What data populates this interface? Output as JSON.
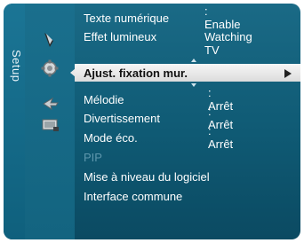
{
  "side_tab": {
    "label": "Setup"
  },
  "icons": [
    {
      "name": "picture-icon"
    },
    {
      "name": "setup-icon"
    },
    {
      "name": "input-icon"
    },
    {
      "name": "application-icon"
    }
  ],
  "menu": {
    "items": [
      {
        "label": "Texte numérique",
        "value": ": Enable"
      },
      {
        "label": "Effet lumineux",
        "value": ": Watching TV"
      },
      {
        "label": "Ajust. fixation mur.",
        "selected": true
      },
      {
        "label": "Mélodie",
        "value": ": Arrêt"
      },
      {
        "label": "Divertissement",
        "value": ": Arrêt"
      },
      {
        "label": "Mode éco.",
        "value": ": Arrêt"
      },
      {
        "label": "PIP",
        "disabled": true
      },
      {
        "label": "Mise à niveau du logiciel"
      },
      {
        "label": "Interface commune"
      }
    ]
  },
  "colors": {
    "background": "#0f5a74",
    "selected_bar": "#e8e8e8",
    "text": "#ffffff",
    "disabled_text": "#5e97ad"
  }
}
